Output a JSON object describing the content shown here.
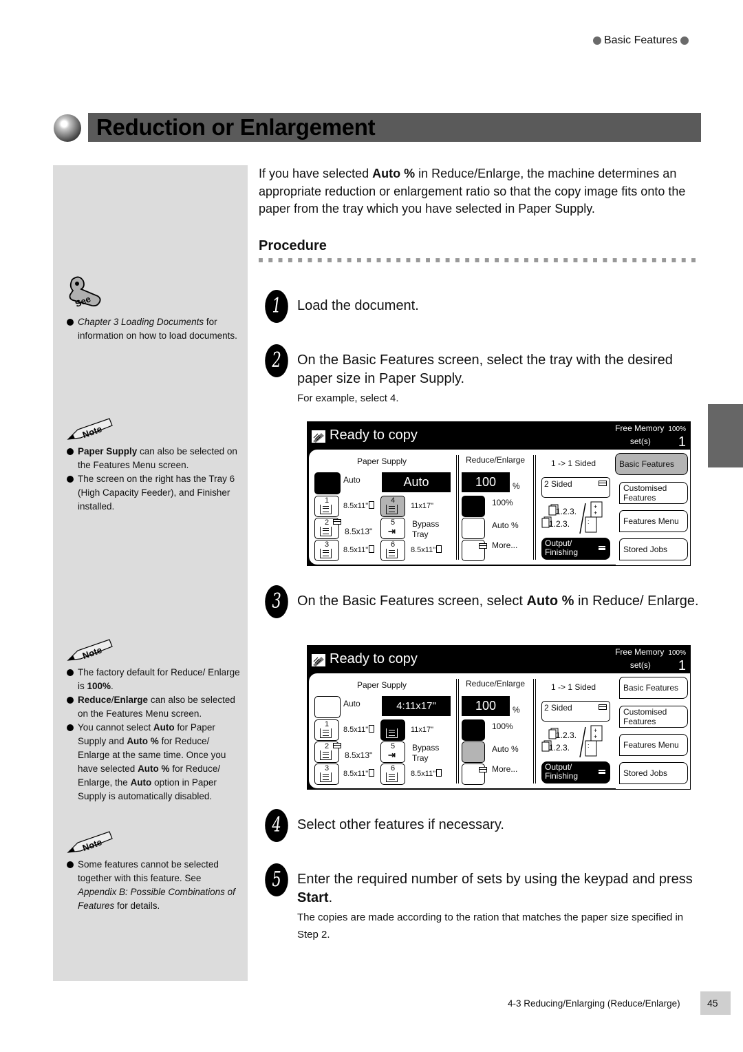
{
  "header": {
    "section": "Basic Features"
  },
  "title": "Reduction or Enlargement",
  "intro": {
    "before": "If you have selected ",
    "bold": "Auto %",
    "after": " in Reduce/Enlarge, the machine determines an appropriate reduction or enlargement ratio so that the copy image fits onto the paper from the tray which you have selected in Paper Supply."
  },
  "procedure_heading": "Procedure",
  "sidebar": {
    "see": {
      "icon_label": "See",
      "items": [
        {
          "italic": "Chapter 3 Loading Documents",
          "text": " for information on how to load documents."
        }
      ]
    },
    "note1": {
      "icon_label": "Note",
      "items": [
        {
          "bold": "Paper Supply",
          "text": " can also be selected on the Features Menu screen."
        },
        {
          "text": "The screen on the right has the Tray 6 (High Capacity Feeder), and Finisher installed."
        }
      ]
    },
    "note2": {
      "icon_label": "Note",
      "items": [
        {
          "t1": "The factory default for Reduce/ Enlarge is ",
          "b1": "100%",
          "t2": "."
        },
        {
          "b1": "Reduce",
          "t1": "/",
          "b2": "Enlarge",
          "t2": " can also be selected on the Features Menu screen."
        },
        {
          "t1": "You cannot select ",
          "b1": "Auto",
          "t2": " for Paper Supply and ",
          "b2": "Auto %",
          "t3": " for Reduce/ Enlarge at the same time. Once you have selected ",
          "b3": "Auto %",
          "t4": " for Reduce/ Enlarge, the ",
          "b4": "Auto",
          "t5": " option in Paper Supply is automatically disabled."
        }
      ]
    },
    "note3": {
      "icon_label": "Note",
      "items": [
        {
          "t1": "Some features cannot be selected together with this feature. See ",
          "i1": "Appendix B: Possible Combinations of Features",
          "t2": " for details."
        }
      ]
    }
  },
  "steps": [
    {
      "num": "1",
      "text": "Load the document."
    },
    {
      "num": "2",
      "text": "On the Basic Features screen, select the tray with the desired paper size in Paper Supply.",
      "sub": "For example, select 4."
    },
    {
      "num": "3",
      "t1": "On the Basic Features screen, select ",
      "b1": "Auto %",
      "t2": " in Reduce/ Enlarge."
    },
    {
      "num": "4",
      "text": "Select other features if necessary."
    },
    {
      "num": "5",
      "t1": "Enter the required number of sets by using the keypad and press ",
      "b1": "Start",
      "t2": ".",
      "sub": "The copies are made according to the ration that matches the paper size specified in Step 2."
    }
  ],
  "screens": [
    {
      "status": "Ready to copy",
      "free_memory_label": "Free Memory",
      "free_memory_value": "100%",
      "sets_label": "set(s)",
      "sets_value": "1",
      "paper_supply_label": "Paper Supply",
      "paper_display": "Auto",
      "auto_label": "Auto",
      "trays": [
        {
          "num": "1",
          "size": "8.5x11\""
        },
        {
          "num": "2",
          "size": "8.5x13\""
        },
        {
          "num": "3",
          "size": "8.5x11\""
        },
        {
          "num": "4",
          "size": "11x17\""
        },
        {
          "num": "5",
          "size": "Bypass Tray"
        },
        {
          "num": "6",
          "size": "8.5x11\""
        }
      ],
      "selected_tray": "4",
      "reduce_label": "Reduce/Enlarge",
      "ratio_value": "100",
      "ratio_unit": "%",
      "ratio_options": [
        "100%",
        "Auto %",
        "More..."
      ],
      "sided_label": "1 -> 1 Sided",
      "two_sided": "2 Sided",
      "output_btn": "Output/ Finishing",
      "tabs": [
        "Basic Features",
        "Customised Features",
        "Features Menu",
        "Stored Jobs"
      ],
      "active_tab": "Basic Features"
    },
    {
      "status": "Ready to copy",
      "free_memory_label": "Free Memory",
      "free_memory_value": "100%",
      "sets_label": "set(s)",
      "sets_value": "1",
      "paper_supply_label": "Paper Supply",
      "paper_display": "4:11x17\"",
      "auto_label": "Auto",
      "trays": [
        {
          "num": "1",
          "size": "8.5x11\""
        },
        {
          "num": "2",
          "size": "8.5x13\""
        },
        {
          "num": "3",
          "size": "8.5x11\""
        },
        {
          "num": "4",
          "size": "11x17\""
        },
        {
          "num": "5",
          "size": "Bypass Tray"
        },
        {
          "num": "6",
          "size": "8.5x11\""
        }
      ],
      "selected_tray": "4",
      "reduce_label": "Reduce/Enlarge",
      "ratio_value": "100",
      "ratio_unit": "%",
      "ratio_options": [
        "100%",
        "Auto %",
        "More..."
      ],
      "selected_ratio": "Auto %",
      "sided_label": "1 -> 1 Sided",
      "two_sided": "2 Sided",
      "output_btn": "Output/ Finishing",
      "tabs": [
        "Basic Features",
        "Customised Features",
        "Features Menu",
        "Stored Jobs"
      ],
      "active_tab": "none"
    }
  ],
  "footer": {
    "section": "4-3  Reducing/Enlarging (Reduce/Enlarge)",
    "page": "45"
  }
}
